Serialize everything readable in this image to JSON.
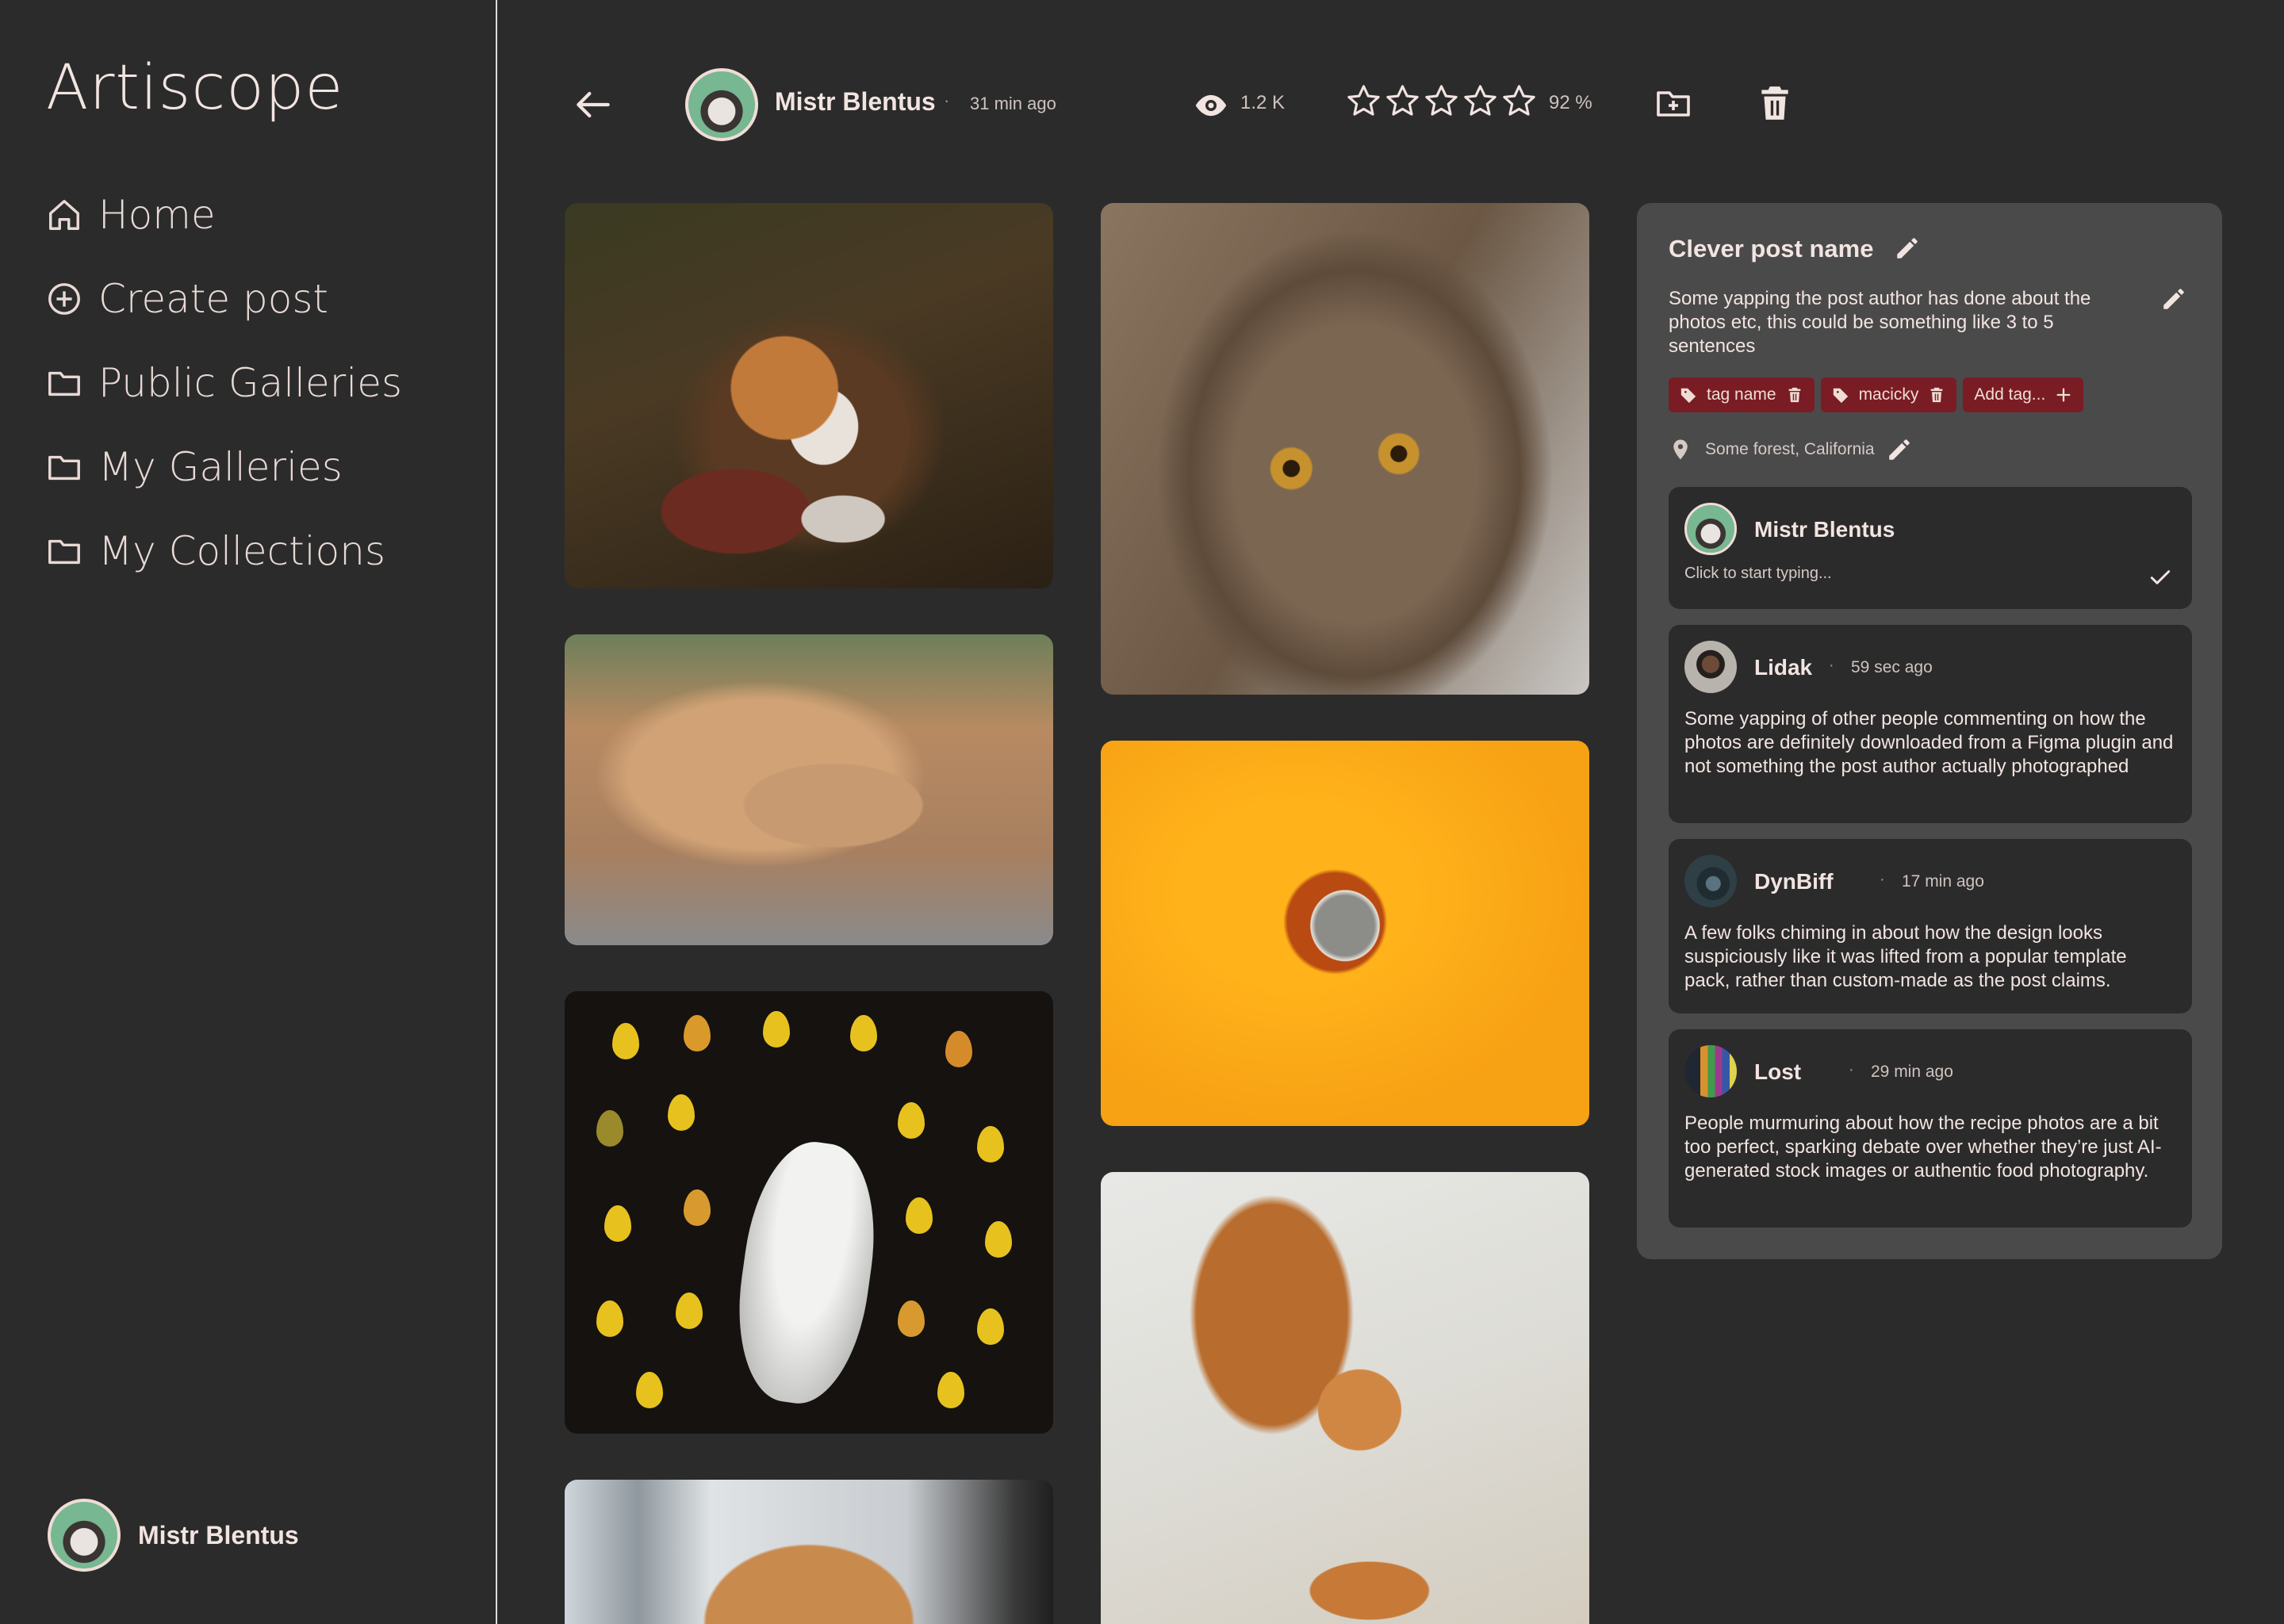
{
  "app": {
    "title": "Artiscope"
  },
  "nav": [
    {
      "label": "Home",
      "icon": "home-icon"
    },
    {
      "label": "Create post",
      "icon": "plus-circle-icon"
    },
    {
      "label": "Public Galleries",
      "icon": "folder-icon"
    },
    {
      "label": "My Galleries",
      "icon": "folder-icon"
    },
    {
      "label": "My Collections",
      "icon": "folder-icon"
    }
  ],
  "current_user": {
    "name": "Mistr Blentus"
  },
  "post": {
    "author": "Mistr Blentus",
    "separator": "·",
    "posted_ago": "31 min ago",
    "views": "1.2 K",
    "rating_label": "92 %",
    "stars_total": 5,
    "title": "Clever post name",
    "description": "Some yapping the post author has done about the photos etc, this could be something like 3 to 5 sentences",
    "tags": [
      "tag name",
      "macicky"
    ],
    "add_tag_label": "Add tag...",
    "location": "Some forest, California"
  },
  "comment_input": {
    "author": "Mistr Blentus",
    "placeholder": "Click to start typing..."
  },
  "comments": [
    {
      "author": "Lidak",
      "time": "59 sec ago",
      "text": "Some yapping of other people commenting on how the photos are definitely downloaded from a Figma plugin and not something the post author actually photographed"
    },
    {
      "author": "DynBiff",
      "time": "17 min ago",
      "text": "A few folks chiming in about how the design looks suspiciously like it was lifted from a popular template pack, rather than custom-made as the post claims."
    },
    {
      "author": "Lost",
      "time": "29 min ago",
      "text": "People murmuring about how the recipe photos are a bit too perfect, sparking debate over whether they’re just AI-generated stock images or authentic food photography."
    }
  ],
  "colors": {
    "background": "#2b2b2b",
    "panel": "#4a4a4a",
    "tag": "#7a1c24",
    "text": "#f2e4e1"
  }
}
